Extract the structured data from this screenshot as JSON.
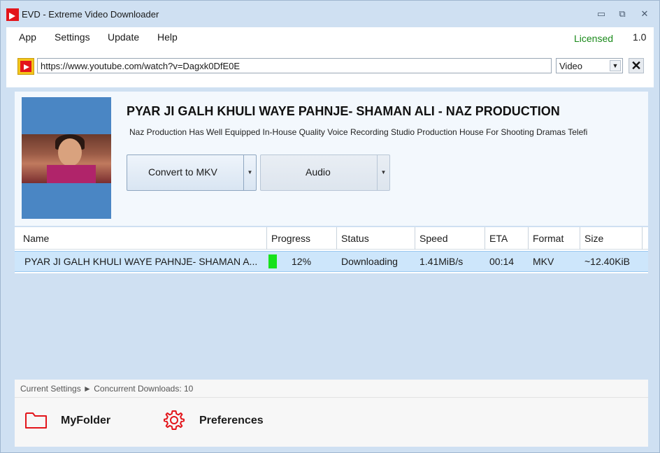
{
  "window": {
    "title": "EVD - Extreme Video Downloader",
    "controls": {
      "minimize": "▭",
      "maximize": "⧉",
      "close": "✕"
    }
  },
  "menu": {
    "items": [
      "App",
      "Settings",
      "Update",
      "Help"
    ],
    "license_status": "Licensed",
    "version": "1.0"
  },
  "url_bar": {
    "url": "https://www.youtube.com/watch?v=Dagxk0DfE0E",
    "format_selected": "Video",
    "clear_glyph": "✕"
  },
  "video": {
    "title": "PYAR JI GALH KHULI WAYE PAHNJE- SHAMAN ALI - NAZ PRODUCTION",
    "description": "Naz Production Has Well Equipped  In-House  Quality Voice Recording Studio  Production House For Shooting Dramas  Telefi",
    "convert_label": "Convert to MKV",
    "audio_label": "Audio",
    "dropdown_glyph": "▼"
  },
  "table": {
    "columns": [
      "Name",
      "Progress",
      "Status",
      "Speed",
      "ETA",
      "Format",
      "Size"
    ],
    "rows": [
      {
        "name": "PYAR JI GALH KHULI WAYE PAHNJE- SHAMAN A...",
        "progress": "12%",
        "progress_value": 0.12,
        "status": "Downloading",
        "speed": "1.41MiB/s",
        "eta": "00:14",
        "format": "MKV",
        "size": "~12.40KiB"
      }
    ]
  },
  "status_line": "Current Settings ► Concurrent Downloads: 10",
  "footer": {
    "folder_label": "MyFolder",
    "preferences_label": "Preferences"
  },
  "colors": {
    "accent_red": "#e3151b",
    "licensed_green": "#1a8a1a",
    "progress_green": "#17e21b",
    "selection_blue": "#cde6fb"
  }
}
